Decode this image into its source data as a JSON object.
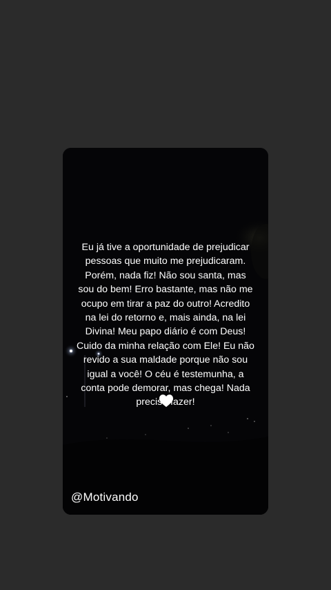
{
  "story": {
    "quote": "Eu já tive a oportunidade de prejudicar\npessoas que muito me prejudicaram.\nPorém, nada fiz!  Não sou santa, mas\nsou do bem! Erro bastante, mas não me\nocupo em tirar a paz do outro! Acredito\nna lei do retorno e, mais ainda, na lei\nDivina! Meu papo diário é com Deus!\nCuido da minha relação com Ele! Eu não\nrevido a sua maldade porque não sou\nigual a você! O céu é testemunha, a\nconta pode demorar, mas chega! Nada\npreciso fazer!",
    "emoji": "white-heart",
    "handle": "@Motivando"
  },
  "colors": {
    "page_background": "#2b2b2b",
    "card_background": "#050507",
    "text": "#ffffff"
  }
}
